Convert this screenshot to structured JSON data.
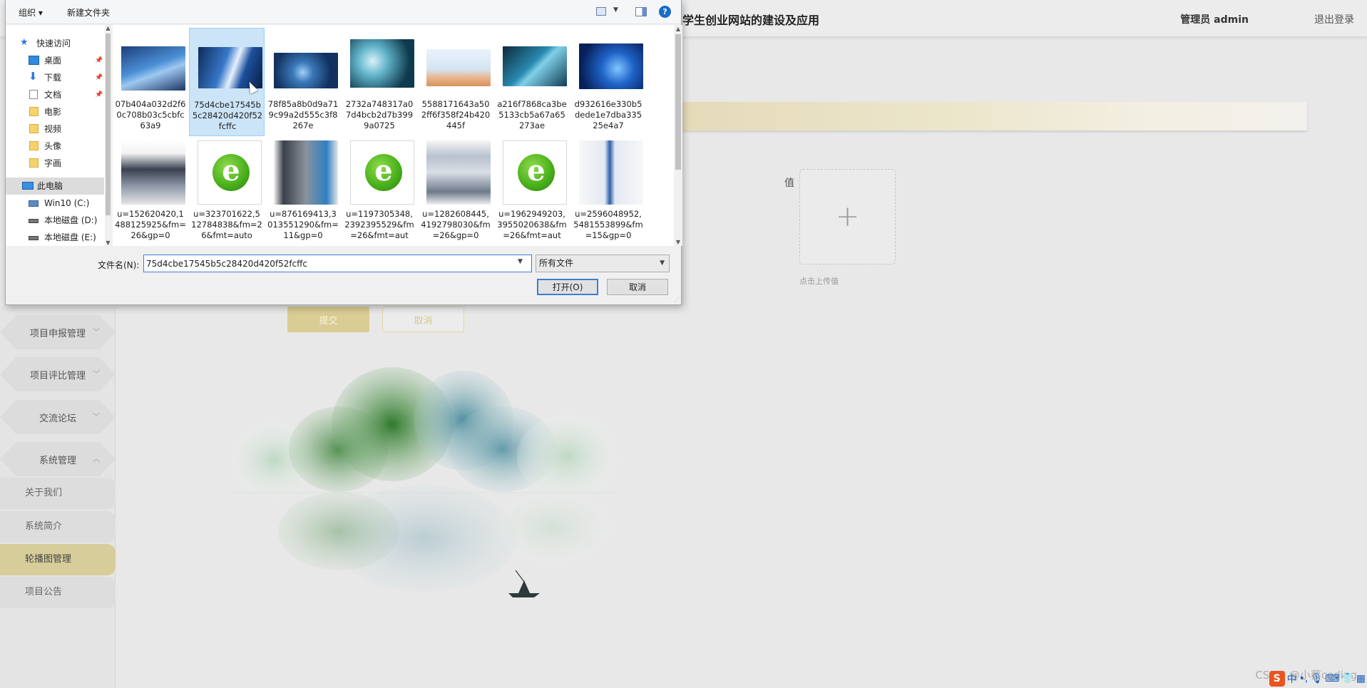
{
  "app": {
    "title": "学生创业网站的建设及应用",
    "user": "管理员 admin",
    "logout": "退出登录"
  },
  "sidebar": {
    "groups": [
      {
        "label": "项目申报管理",
        "chevron": "down"
      },
      {
        "label": "项目评比管理",
        "chevron": "down"
      },
      {
        "label": "交流论坛",
        "chevron": "down"
      },
      {
        "label": "系统管理",
        "chevron": "up"
      }
    ],
    "sub_items": [
      {
        "label": "关于我们",
        "active": false
      },
      {
        "label": "系统简介",
        "active": false
      },
      {
        "label": "轮播图管理",
        "active": true
      },
      {
        "label": "项目公告",
        "active": false
      }
    ]
  },
  "form": {
    "value_label": "值",
    "upload_hint": "点击上传值",
    "submit": "提交",
    "cancel": "取消"
  },
  "dialog": {
    "toolbar": {
      "organize": "组织 ▾",
      "new_folder": "新建文件夹",
      "help": "?"
    },
    "nav": [
      {
        "label": "快速访问",
        "icon": "star-icon",
        "pinned": false
      },
      {
        "label": "桌面",
        "icon": "desktop-icon",
        "pinned": true
      },
      {
        "label": "下载",
        "icon": "download-icon",
        "pinned": true
      },
      {
        "label": "文档",
        "icon": "document-icon",
        "pinned": true
      },
      {
        "label": "电影",
        "icon": "folder-icon",
        "pinned": false
      },
      {
        "label": "视频",
        "icon": "folder-icon",
        "pinned": false
      },
      {
        "label": "头像",
        "icon": "folder-icon",
        "pinned": false
      },
      {
        "label": "字画",
        "icon": "folder-icon",
        "pinned": false
      },
      {
        "label": "此电脑",
        "icon": "computer-icon",
        "pinned": false
      },
      {
        "label": "Win10 (C:)",
        "icon": "drive-icon",
        "pinned": false
      },
      {
        "label": "本地磁盘 (D:)",
        "icon": "drive-icon",
        "pinned": false
      },
      {
        "label": "本地磁盘 (E:)",
        "icon": "drive-icon",
        "pinned": false
      }
    ],
    "files": [
      {
        "name": "07b404a032d2f60c708b03c5cbfc63a9",
        "kind": "image"
      },
      {
        "name": "75d4cbe17545b5c28420d420f52fcffc",
        "kind": "image"
      },
      {
        "name": "78f85a8b0d9a719c99a2d555c3f8267e",
        "kind": "image"
      },
      {
        "name": "2732a748317a07d4bcb2d7b3999a0725",
        "kind": "image"
      },
      {
        "name": "5588171643a502ff6f358f24b420445f",
        "kind": "image"
      },
      {
        "name": "a216f7868ca3be5133cb5a67a65273ae",
        "kind": "image"
      },
      {
        "name": "d932616e330b5dede1e7dba33525e4a7",
        "kind": "image"
      },
      {
        "name": "u=152620420,1488125925&fm=26&gp=0",
        "kind": "image"
      },
      {
        "name": "u=323701622,512784838&fm=26&fmt=auto",
        "kind": "ie"
      },
      {
        "name": "u=876169413,3013551290&fm=11&gp=0",
        "kind": "image"
      },
      {
        "name": "u=1197305348,2392395529&fm=26&fmt=aut",
        "kind": "ie"
      },
      {
        "name": "u=1282608445,4192798030&fm=26&gp=0",
        "kind": "image"
      },
      {
        "name": "u=1962949203,3955020638&fm=26&fmt=aut",
        "kind": "ie"
      },
      {
        "name": "u=2596048952,5481553899&fm=15&gp=0",
        "kind": "image"
      }
    ],
    "selected_file": "75d4cbe17545b5c28420d420f52fcffc",
    "filename_label": "文件名(N):",
    "filename_value": "75d4cbe17545b5c28420d420f52fcffc",
    "filetype": "所有文件",
    "open": "打开(O)",
    "cancel": "取消"
  },
  "watermark": "CSDN @小蔡coding",
  "tray": {
    "ime": "中"
  },
  "colors": {
    "accent_gold": "#d9cd93",
    "active_menu": "#d7cd9a",
    "selection_blue": "#cce4f7",
    "focus_blue": "#3c7fd2"
  }
}
